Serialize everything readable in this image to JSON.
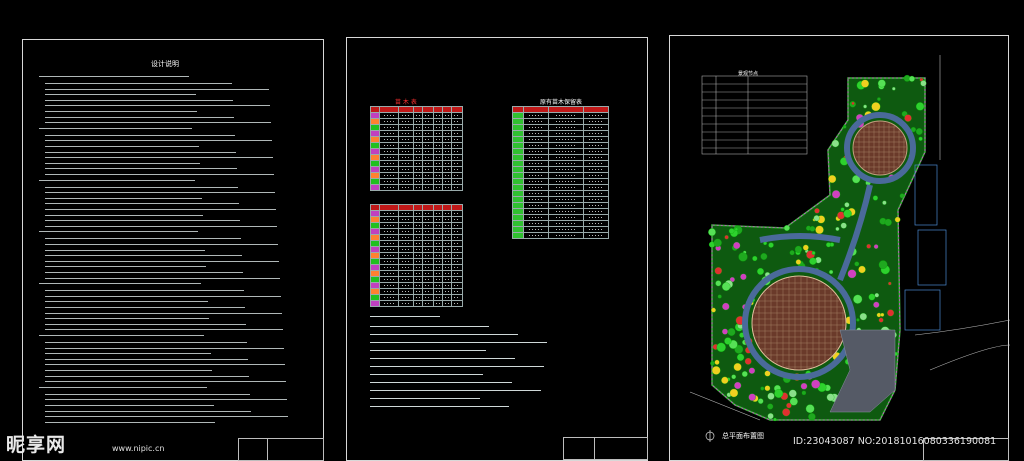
{
  "sheets": {
    "design_notes": {
      "title": "设计说明"
    },
    "legend": {
      "seedling_title": "苗 木 表",
      "shrub_title": "原有苗木保留表"
    },
    "plan": {
      "table_title": "景观节点",
      "label": "总平面布置图"
    }
  },
  "watermark": {
    "brand": "昵享网",
    "url": "www.nipic.cn"
  },
  "image_id": "ID:23043087 NO:20181016080336190081",
  "colors": {
    "green": "#1fb21f",
    "red": "#e02020",
    "paving": "#8a5a4a",
    "road": "#5a6a8a"
  }
}
